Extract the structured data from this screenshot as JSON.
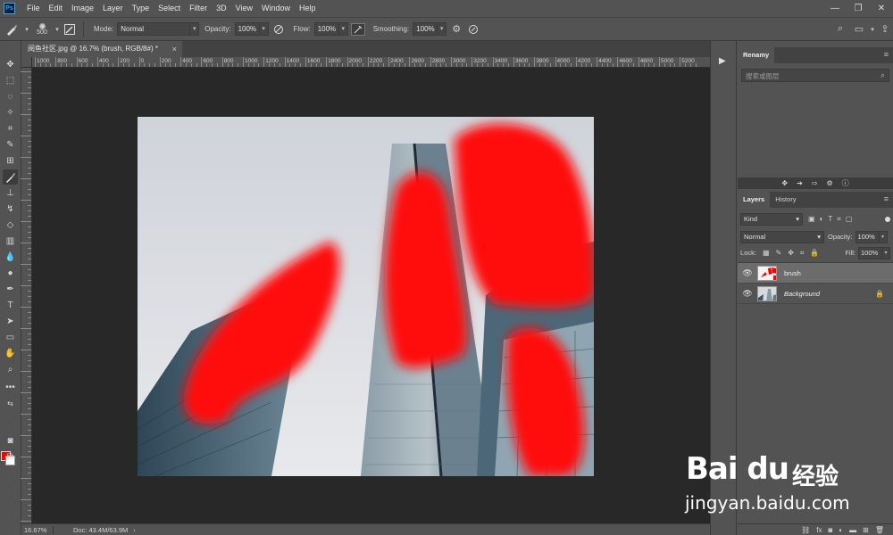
{
  "menubar": {
    "logo": "Ps",
    "items": [
      "File",
      "Edit",
      "Image",
      "Layer",
      "Type",
      "Select",
      "Filter",
      "3D",
      "View",
      "Window",
      "Help"
    ],
    "window_controls": [
      "—",
      "❐",
      "✕"
    ]
  },
  "options": {
    "brush_size": "500",
    "mode_label": "Mode:",
    "mode_value": "Normal",
    "opacity_label": "Opacity:",
    "opacity_value": "100%",
    "flow_label": "Flow:",
    "flow_value": "100%",
    "smoothing_label": "Smoothing:",
    "smoothing_value": "100%"
  },
  "document": {
    "tab_title": "阅鱼社区.jpg @ 16.7% (brush, RGB/8#) *",
    "close_glyph": "×"
  },
  "ruler": {
    "labels": [
      "1000",
      "800",
      "600",
      "400",
      "200",
      "0",
      "200",
      "400",
      "600",
      "800",
      "1000",
      "1200",
      "1400",
      "1600",
      "1800",
      "2000",
      "2200",
      "2400",
      "2600",
      "2800",
      "3000",
      "3200",
      "3400",
      "3600",
      "3800",
      "4000",
      "4200",
      "4400",
      "4600",
      "4800",
      "5000",
      "5200"
    ]
  },
  "status": {
    "zoom": "16.67%",
    "doc": "Doc: 43.4M/63.9M",
    "arrow": "›"
  },
  "colors": {
    "foreground": "#ff0000",
    "background": "#ffffff",
    "paint": "#ff0000"
  },
  "renamy": {
    "tab": "Renamy",
    "search_placeholder": "搜索或图层"
  },
  "layers_panel": {
    "tab_layers": "Layers",
    "tab_history": "History",
    "kind": "Kind",
    "blend_mode": "Normal",
    "opacity_label": "Opacity:",
    "opacity_value": "100%",
    "lock_label": "Lock:",
    "fill_label": "Fill:",
    "fill_value": "100%",
    "layers": [
      {
        "name": "brush"
      },
      {
        "name": "Background"
      }
    ]
  },
  "watermark": {
    "logo": "Bai du",
    "cn": "经验",
    "url": "jingyan.baidu.com"
  }
}
